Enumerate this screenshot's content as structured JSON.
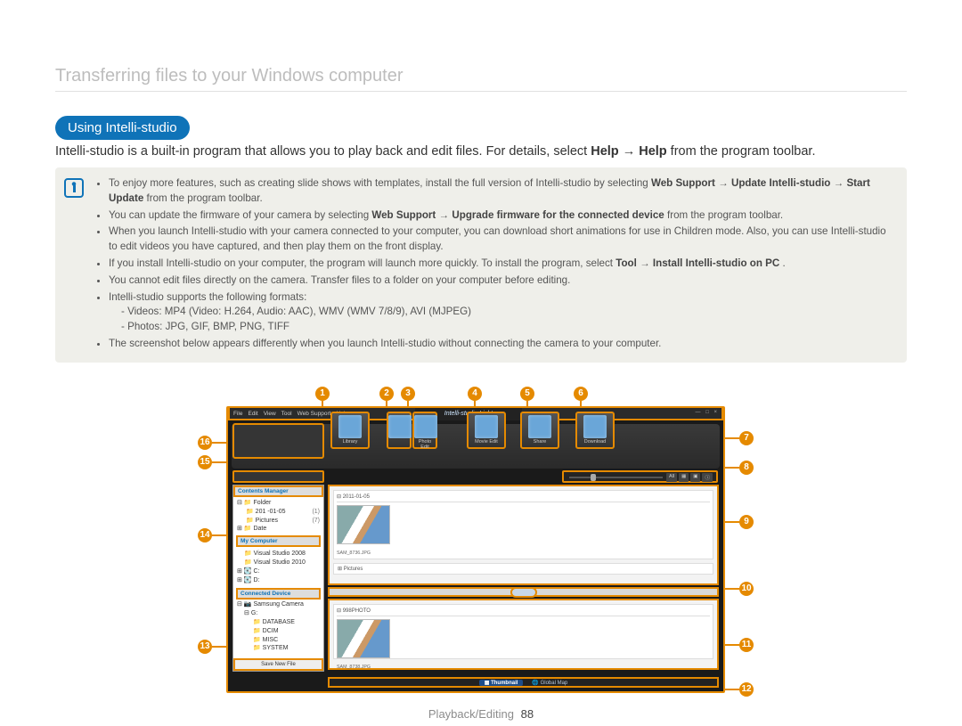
{
  "page": {
    "title": "Transferring files to your Windows computer",
    "footer_section": "Playback/Editing",
    "footer_page": "88"
  },
  "section": {
    "pill": "Using Intelli-studio",
    "intro_pre": "Intelli-studio is a built-in program that allows you to play back and edit files. For details, select ",
    "intro_b1": "Help",
    "intro_arrow": " → ",
    "intro_b2": "Help",
    "intro_post": " from the program toolbar."
  },
  "info": {
    "b1_pre": "To enjoy more features, such as creating slide shows with templates, install the full version of Intelli-studio by selecting ",
    "b1_b1": "Web Support",
    "b1_mid1": " → ",
    "b1_b2": "Update Intelli-studio",
    "b1_mid2": " → ",
    "b1_b3": "Start Update",
    "b1_post": " from the program toolbar.",
    "b2_pre": "You can update the firmware of your camera by selecting ",
    "b2_b1": "Web Support",
    "b2_mid1": " → ",
    "b2_b2": "Upgrade firmware for the connected device",
    "b2_post": " from the program toolbar.",
    "b3": "When you launch Intelli-studio with your camera connected to your computer, you can download short animations for use in Children mode. Also, you can use Intelli-studio to edit videos you have captured, and then play them on the front display.",
    "b4_pre": "If you install Intelli-studio on your computer, the program will launch more quickly. To install the program, select ",
    "b4_b1": "Tool",
    "b4_mid1": " → ",
    "b4_b2": "Install Intelli-studio on PC",
    "b4_post": ".",
    "b5": "You cannot edit files directly on the camera. Transfer files to a folder on your computer before editing.",
    "b6": "Intelli-studio supports the following formats:",
    "b6_sub1": "- Videos: MP4 (Video: H.264, Audio: AAC), WMV (WMV 7/8/9), AVI (MJPEG)",
    "b6_sub2": "- Photos: JPG, GIF, BMP, PNG, TIFF",
    "b7": "The screenshot below appears differently when you launch Intelli-studio without connecting the camera to your computer."
  },
  "callouts": {
    "c1": "1",
    "c2": "2",
    "c3": "3",
    "c4": "4",
    "c5": "5",
    "c6": "6",
    "c7": "7",
    "c8": "8",
    "c9": "9",
    "c10": "10",
    "c11": "11",
    "c12": "12",
    "c13": "13",
    "c14": "14",
    "c15": "15",
    "c16": "16"
  },
  "app": {
    "logo": "Intelli-studio Light",
    "menu": {
      "file": "File",
      "edit": "Edit",
      "view": "View",
      "tool": "Tool",
      "web": "Web Support",
      "help": "Help"
    },
    "window_controls": "— □ ×",
    "toolbar": {
      "library": "Library",
      "photo_edit": "Photo Edit",
      "movie_edit": "Movie Edit",
      "share": "Share",
      "download": "Download"
    },
    "slider": {
      "all": "All"
    },
    "sidebar": {
      "contents_hdr": "Contents Manager",
      "folder_root": "Folder",
      "folder_date": "201 -01-05",
      "folder_date_count": "(1)",
      "folder_pictures": "Pictures",
      "folder_pictures_count": "(7)",
      "date_root": "Date",
      "mycomputer_hdr": "My Computer",
      "vs2008": "Visual Studio 2008",
      "vs2010": "Visual Studio 2010",
      "drive_c": "C:",
      "drive_d": "D:",
      "connected_hdr": "Connected Device",
      "cam": "Samsung Camera",
      "drive_g": "G:",
      "g_database": "DATABASE",
      "g_dcim": "DCIM",
      "g_misc": "MISC",
      "g_system": "SYSTEM",
      "save_new": "Save New File"
    },
    "main": {
      "date1": "2011-01-05",
      "file1": "SAM_8736.JPG",
      "pictures_bar": "Pictures",
      "folder2": "998PHOTO",
      "file2": "SAM_8738.JPG"
    },
    "footer": {
      "thumbnail": "Thumbnail",
      "global_map": "Global Map"
    }
  }
}
